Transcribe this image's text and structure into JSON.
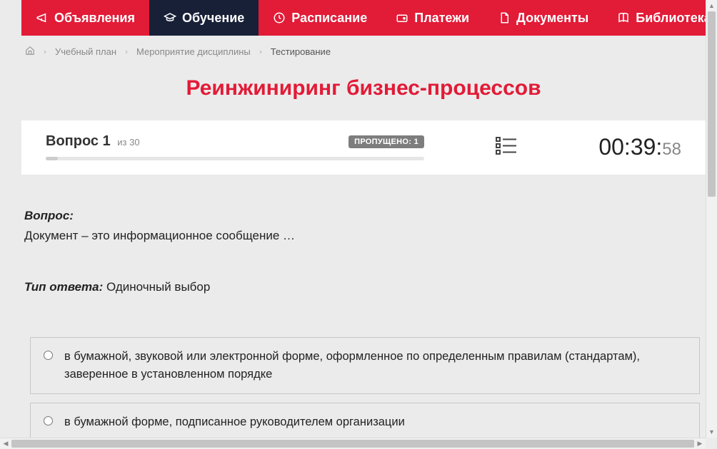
{
  "nav": {
    "items": [
      {
        "label": "Объявления",
        "active": false
      },
      {
        "label": "Обучение",
        "active": true
      },
      {
        "label": "Расписание",
        "active": false
      },
      {
        "label": "Платежи",
        "active": false
      },
      {
        "label": "Документы",
        "active": false
      },
      {
        "label": "Библиотека",
        "active": false,
        "dropdown": true
      }
    ]
  },
  "breadcrumb": {
    "items": [
      {
        "label": "Учебный план"
      },
      {
        "label": "Мероприятие дисциплины"
      },
      {
        "label": "Тестирование",
        "current": true
      }
    ]
  },
  "page_title": "Реинжиниринг бизнес-процессов",
  "status": {
    "question_prefix": "Вопрос",
    "question_number": "1",
    "total_prefix": "из",
    "total": "30",
    "skipped_label": "ПРОПУЩЕНО: 1"
  },
  "timer": {
    "main": "00:39:",
    "seconds": "58"
  },
  "question": {
    "label": "Вопрос:",
    "text": "Документ – это информационное сообщение …"
  },
  "answer_type": {
    "label": "Тип ответа:",
    "value": "Одиночный выбор"
  },
  "answers": [
    {
      "text": "в бумажной, звуковой или электронной форме, оформленное по определенным правилам (стандартам), заверенное в установленном порядке"
    },
    {
      "text": "в бумажной форме, подписанное руководителем организации"
    }
  ]
}
